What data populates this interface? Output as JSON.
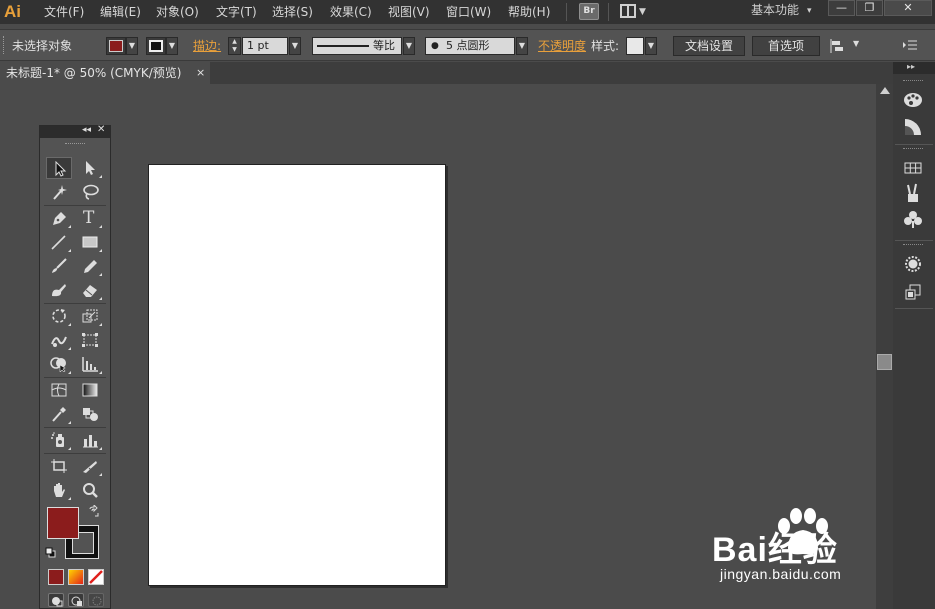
{
  "app": {
    "logo_text": "Ai"
  },
  "menu": {
    "items": [
      "文件(F)",
      "编辑(E)",
      "对象(O)",
      "文字(T)",
      "选择(S)",
      "效果(C)",
      "视图(V)",
      "窗口(W)",
      "帮助(H)"
    ],
    "bridge_label": "Br",
    "workspace_label": "基本功能",
    "window_controls": {
      "minimize": "—",
      "restore": "❐",
      "close": "✕"
    }
  },
  "control_bar": {
    "selection_status": "未选择对象",
    "stroke_label": "描边:",
    "stroke_weight": "1 pt",
    "stroke_profile": "等比",
    "brush_label": "5 点圆形",
    "opacity_label": "不透明度",
    "style_label": "样式:",
    "document_setup": "文档设置",
    "preferences": "首选项",
    "fill_color": "#8b1c1c"
  },
  "document": {
    "tab_title": "未标题-1* @ 50% (CMYK/预览)",
    "tab_close": "×"
  },
  "tools": {
    "fill_color": "#8b1c1c",
    "stroke_color": "#111111",
    "rows": [
      [
        "selection-tool",
        "direct-selection-tool"
      ],
      [
        "magic-wand-tool",
        "lasso-tool"
      ],
      [
        "pen-tool",
        "type-tool"
      ],
      [
        "line-segment-tool",
        "rectangle-tool"
      ],
      [
        "paintbrush-tool",
        "pencil-tool"
      ],
      [
        "blob-brush-tool",
        "eraser-tool"
      ],
      [
        "rotate-tool",
        "scale-tool"
      ],
      [
        "warp-tool",
        "free-transform-tool"
      ],
      [
        "shape-builder-tool",
        "graph-tool"
      ],
      [
        "mesh-tool",
        "gradient-tool"
      ],
      [
        "eyedropper-tool",
        "blend-tool"
      ],
      [
        "symbol-sprayer-tool",
        "column-graph-tool"
      ],
      [
        "artboard-tool",
        "slice-tool"
      ],
      [
        "hand-tool",
        "zoom-tool"
      ]
    ],
    "type_tool_glyph": "T"
  },
  "right_dock": {
    "icons": [
      "color-icon",
      "color-guide-icon",
      "swatches-icon",
      "brushes-icon",
      "symbols-icon",
      "appearance-icon",
      "graphic-styles-icon"
    ]
  },
  "watermark": {
    "brand": "Bai经验",
    "url": "jingyan.baidu.com"
  }
}
